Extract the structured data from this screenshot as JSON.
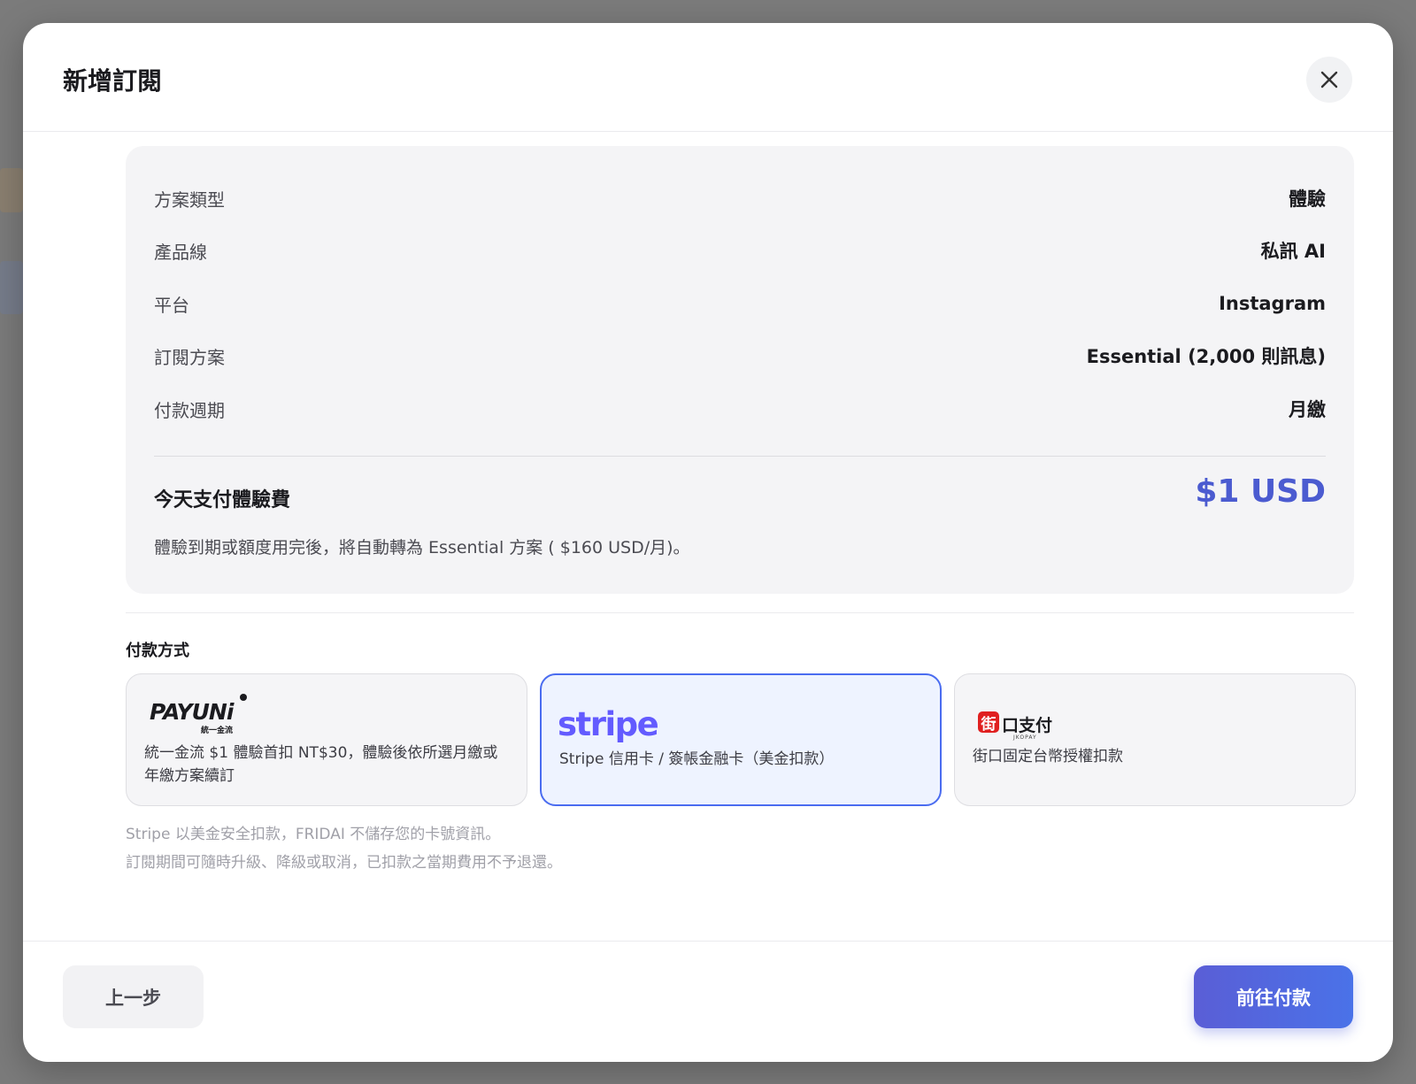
{
  "modal": {
    "title": "新增訂閱"
  },
  "summary": {
    "rows": [
      {
        "label": "方案類型",
        "value": "體驗"
      },
      {
        "label": "產品線",
        "value": "私訊 AI"
      },
      {
        "label": "平台",
        "value": "Instagram"
      },
      {
        "label": "訂閱方案",
        "value": "Essential (2,000 則訊息)"
      },
      {
        "label": "付款週期",
        "value": "月繳"
      }
    ],
    "today_label": "今天支付體驗費",
    "today_price": "$1 USD",
    "note": "體驗到期或額度用完後，將自動轉為 Essential 方案 ( $160 USD/月)。"
  },
  "payment": {
    "title": "付款方式",
    "options": [
      {
        "logo_text": "PAYUNi",
        "logo_sub": "統一金流",
        "desc": "統一金流 $1 體驗首扣 NT$30，體驗後依所選月繳或年繳方案續訂",
        "selected": false
      },
      {
        "logo_text": "stripe",
        "desc": "Stripe 信用卡 / 簽帳金融卡（美金扣款）",
        "selected": true
      },
      {
        "logo_mark": "街",
        "logo_text": "口支付",
        "logo_sub": "JKOPAY",
        "desc": "街口固定台幣授權扣款",
        "selected": false
      }
    ],
    "hints": [
      "Stripe 以美金安全扣款，FRIDAI 不儲存您的卡號資訊。",
      "訂閱期間可隨時升級、降級或取消，已扣款之當期費用不予退還。"
    ]
  },
  "footer": {
    "back_label": "上一步",
    "pay_label": "前往付款"
  },
  "colors": {
    "accent": "#4b5bd0",
    "stripe": "#635bff",
    "jko_red": "#e02020",
    "selected_border": "#4a6cf0"
  }
}
